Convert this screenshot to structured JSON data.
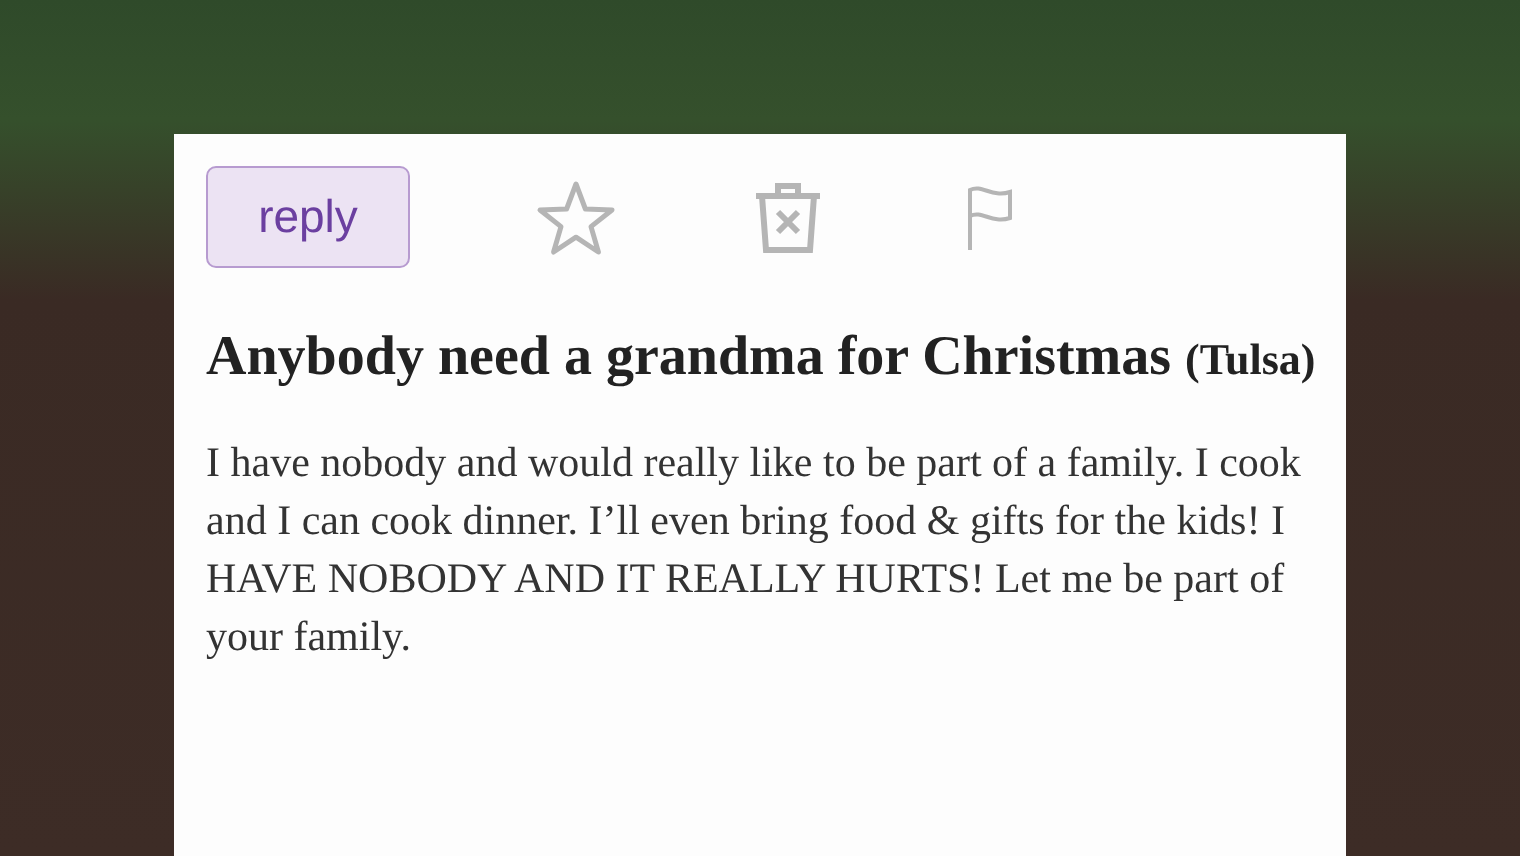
{
  "post": {
    "reply_button": "reply",
    "title": "Anybody need a grandma for Christmas",
    "location": "(Tulsa)",
    "body": "I have nobody and would really like to be part of a family. I cook and I can cook dinner. I’ll even bring food & gifts for the kids! I HAVE NOBODY AND IT REALLY HURTS! Let me be part of your family."
  }
}
